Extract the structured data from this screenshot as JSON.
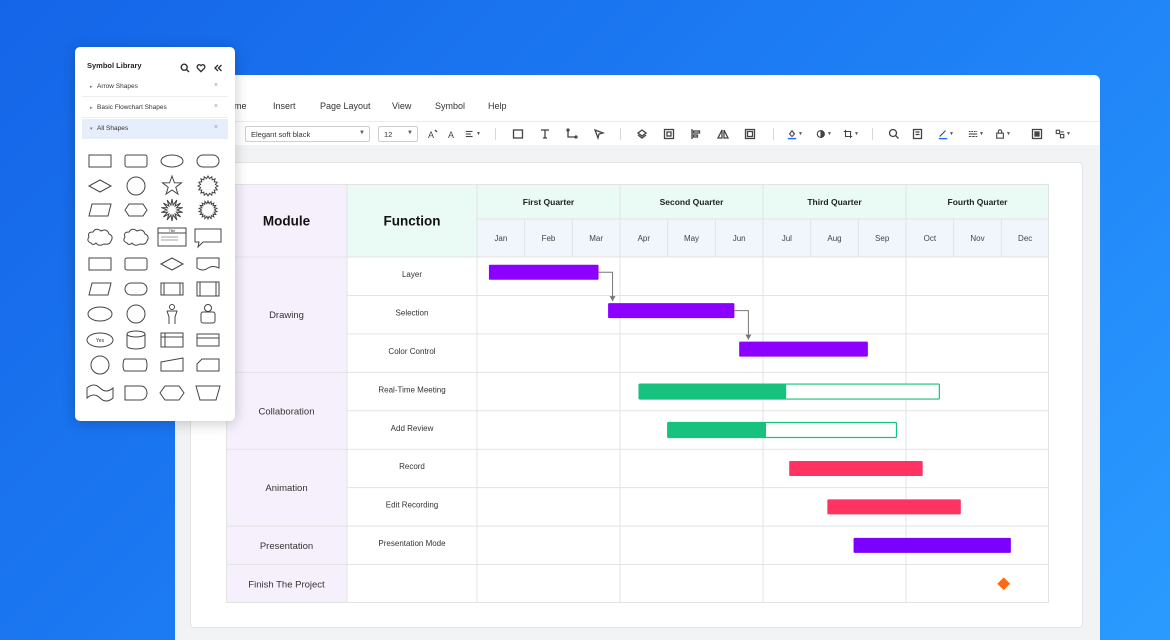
{
  "menu": [
    "ome",
    "Insert",
    "Page Layout",
    "View",
    "Symbol",
    "Help"
  ],
  "toolbar": {
    "font": "Elegant soft black",
    "font_size": "12",
    "icons": [
      "increase-font-icon",
      "decrease-font-icon",
      "align-text-icon",
      "rectangle-icon",
      "text-icon",
      "connector-icon",
      "pointer-icon",
      "layers-icon",
      "group-icon",
      "align-left-icon",
      "flip-icon",
      "frame-icon",
      "fill-color-icon",
      "shadow-icon",
      "crop-icon",
      "search-icon",
      "format-painter-icon",
      "line-color-icon",
      "line-style-icon",
      "lock-icon",
      "fit-page-icon",
      "more-icon"
    ]
  },
  "symbol_library": {
    "title": "Symbol Library",
    "categories": [
      {
        "label": "Arrow Shapes",
        "active": false
      },
      {
        "label": "Basic Flowchart Shapes",
        "active": false
      },
      {
        "label": "All Shapes",
        "active": true
      }
    ],
    "callout_text": "Title",
    "yes_label": "Yes"
  },
  "gantt": {
    "module_header": "Module",
    "function_header": "Function",
    "quarters": [
      "First Quarter",
      "Second Quarter",
      "Third Quarter",
      "Fourth Quarter"
    ],
    "months": [
      "Jan",
      "Feb",
      "Mar",
      "Apr",
      "May",
      "Jun",
      "Jul",
      "Aug",
      "Sep",
      "Oct",
      "Nov",
      "Dec"
    ],
    "modules": [
      {
        "name": "Drawing",
        "rows": 3
      },
      {
        "name": "Collaboration",
        "rows": 2
      },
      {
        "name": "Animation",
        "rows": 2
      },
      {
        "name": "Presentation",
        "rows": 1
      },
      {
        "name": "Finish The Project",
        "rows": 1
      }
    ],
    "tasks": [
      {
        "name": "Layer",
        "start": 0.25,
        "end": 2.55,
        "progress": 1,
        "color": "#8b00ff"
      },
      {
        "name": "Selection",
        "start": 2.75,
        "end": 5.4,
        "progress": 1,
        "color": "#8b00ff"
      },
      {
        "name": "Color Control",
        "start": 5.5,
        "end": 8.2,
        "progress": 1,
        "color": "#8b00ff"
      },
      {
        "name": "Real-Time Meeting",
        "start": 3.4,
        "end": 9.7,
        "progress": 0.49,
        "color": "#17c27e"
      },
      {
        "name": "Add Review",
        "start": 4.0,
        "end": 8.8,
        "progress": 0.43,
        "color": "#17c27e"
      },
      {
        "name": "Record",
        "start": 6.55,
        "end": 9.35,
        "progress": 1,
        "color": "#ff3362"
      },
      {
        "name": "Edit Recording",
        "start": 7.35,
        "end": 10.15,
        "progress": 1,
        "color": "#ff3362"
      },
      {
        "name": "Presentation Mode",
        "start": 7.9,
        "end": 11.2,
        "progress": 1,
        "color": "#7b00ff"
      },
      {
        "name": "",
        "milestone": 11.05,
        "color": "#ff6a10"
      }
    ],
    "dependencies": [
      [
        0,
        1
      ],
      [
        1,
        2
      ]
    ],
    "colors": {
      "header_bg": "#eafbf5",
      "module_bg": "#f6f0fd",
      "grid": "#e3e3e3"
    }
  }
}
